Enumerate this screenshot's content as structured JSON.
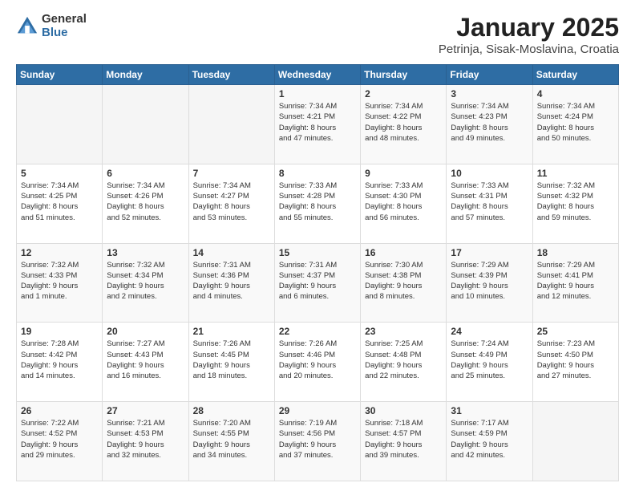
{
  "logo": {
    "general": "General",
    "blue": "Blue"
  },
  "title": "January 2025",
  "subtitle": "Petrinja, Sisak-Moslavina, Croatia",
  "days_of_week": [
    "Sunday",
    "Monday",
    "Tuesday",
    "Wednesday",
    "Thursday",
    "Friday",
    "Saturday"
  ],
  "weeks": [
    [
      {
        "day": "",
        "info": ""
      },
      {
        "day": "",
        "info": ""
      },
      {
        "day": "",
        "info": ""
      },
      {
        "day": "1",
        "info": "Sunrise: 7:34 AM\nSunset: 4:21 PM\nDaylight: 8 hours\nand 47 minutes."
      },
      {
        "day": "2",
        "info": "Sunrise: 7:34 AM\nSunset: 4:22 PM\nDaylight: 8 hours\nand 48 minutes."
      },
      {
        "day": "3",
        "info": "Sunrise: 7:34 AM\nSunset: 4:23 PM\nDaylight: 8 hours\nand 49 minutes."
      },
      {
        "day": "4",
        "info": "Sunrise: 7:34 AM\nSunset: 4:24 PM\nDaylight: 8 hours\nand 50 minutes."
      }
    ],
    [
      {
        "day": "5",
        "info": "Sunrise: 7:34 AM\nSunset: 4:25 PM\nDaylight: 8 hours\nand 51 minutes."
      },
      {
        "day": "6",
        "info": "Sunrise: 7:34 AM\nSunset: 4:26 PM\nDaylight: 8 hours\nand 52 minutes."
      },
      {
        "day": "7",
        "info": "Sunrise: 7:34 AM\nSunset: 4:27 PM\nDaylight: 8 hours\nand 53 minutes."
      },
      {
        "day": "8",
        "info": "Sunrise: 7:33 AM\nSunset: 4:28 PM\nDaylight: 8 hours\nand 55 minutes."
      },
      {
        "day": "9",
        "info": "Sunrise: 7:33 AM\nSunset: 4:30 PM\nDaylight: 8 hours\nand 56 minutes."
      },
      {
        "day": "10",
        "info": "Sunrise: 7:33 AM\nSunset: 4:31 PM\nDaylight: 8 hours\nand 57 minutes."
      },
      {
        "day": "11",
        "info": "Sunrise: 7:32 AM\nSunset: 4:32 PM\nDaylight: 8 hours\nand 59 minutes."
      }
    ],
    [
      {
        "day": "12",
        "info": "Sunrise: 7:32 AM\nSunset: 4:33 PM\nDaylight: 9 hours\nand 1 minute."
      },
      {
        "day": "13",
        "info": "Sunrise: 7:32 AM\nSunset: 4:34 PM\nDaylight: 9 hours\nand 2 minutes."
      },
      {
        "day": "14",
        "info": "Sunrise: 7:31 AM\nSunset: 4:36 PM\nDaylight: 9 hours\nand 4 minutes."
      },
      {
        "day": "15",
        "info": "Sunrise: 7:31 AM\nSunset: 4:37 PM\nDaylight: 9 hours\nand 6 minutes."
      },
      {
        "day": "16",
        "info": "Sunrise: 7:30 AM\nSunset: 4:38 PM\nDaylight: 9 hours\nand 8 minutes."
      },
      {
        "day": "17",
        "info": "Sunrise: 7:29 AM\nSunset: 4:39 PM\nDaylight: 9 hours\nand 10 minutes."
      },
      {
        "day": "18",
        "info": "Sunrise: 7:29 AM\nSunset: 4:41 PM\nDaylight: 9 hours\nand 12 minutes."
      }
    ],
    [
      {
        "day": "19",
        "info": "Sunrise: 7:28 AM\nSunset: 4:42 PM\nDaylight: 9 hours\nand 14 minutes."
      },
      {
        "day": "20",
        "info": "Sunrise: 7:27 AM\nSunset: 4:43 PM\nDaylight: 9 hours\nand 16 minutes."
      },
      {
        "day": "21",
        "info": "Sunrise: 7:26 AM\nSunset: 4:45 PM\nDaylight: 9 hours\nand 18 minutes."
      },
      {
        "day": "22",
        "info": "Sunrise: 7:26 AM\nSunset: 4:46 PM\nDaylight: 9 hours\nand 20 minutes."
      },
      {
        "day": "23",
        "info": "Sunrise: 7:25 AM\nSunset: 4:48 PM\nDaylight: 9 hours\nand 22 minutes."
      },
      {
        "day": "24",
        "info": "Sunrise: 7:24 AM\nSunset: 4:49 PM\nDaylight: 9 hours\nand 25 minutes."
      },
      {
        "day": "25",
        "info": "Sunrise: 7:23 AM\nSunset: 4:50 PM\nDaylight: 9 hours\nand 27 minutes."
      }
    ],
    [
      {
        "day": "26",
        "info": "Sunrise: 7:22 AM\nSunset: 4:52 PM\nDaylight: 9 hours\nand 29 minutes."
      },
      {
        "day": "27",
        "info": "Sunrise: 7:21 AM\nSunset: 4:53 PM\nDaylight: 9 hours\nand 32 minutes."
      },
      {
        "day": "28",
        "info": "Sunrise: 7:20 AM\nSunset: 4:55 PM\nDaylight: 9 hours\nand 34 minutes."
      },
      {
        "day": "29",
        "info": "Sunrise: 7:19 AM\nSunset: 4:56 PM\nDaylight: 9 hours\nand 37 minutes."
      },
      {
        "day": "30",
        "info": "Sunrise: 7:18 AM\nSunset: 4:57 PM\nDaylight: 9 hours\nand 39 minutes."
      },
      {
        "day": "31",
        "info": "Sunrise: 7:17 AM\nSunset: 4:59 PM\nDaylight: 9 hours\nand 42 minutes."
      },
      {
        "day": "",
        "info": ""
      }
    ]
  ]
}
